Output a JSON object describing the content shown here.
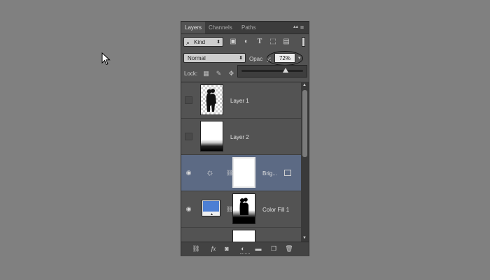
{
  "panel": {
    "tabs": [
      {
        "label": "Layers",
        "active": true
      },
      {
        "label": "Channels",
        "active": false
      },
      {
        "label": "Paths",
        "active": false
      }
    ]
  },
  "filter": {
    "kind_label": "Kind",
    "icons": [
      "image-filter-icon",
      "adjustment-filter-icon",
      "type-filter-icon",
      "shape-filter-icon",
      "smart-object-filter-icon"
    ]
  },
  "blend": {
    "mode": "Normal",
    "opacity_label_head": "Opac",
    "opacity_label_tail": "y:",
    "opacity_value": "72%",
    "opacity_fraction": 0.72
  },
  "lock": {
    "label": "Lock:"
  },
  "layers": [
    {
      "name": "Layer 1",
      "visible": false,
      "selected": false
    },
    {
      "name": "Layer 2",
      "visible": false,
      "selected": false
    },
    {
      "name": "Brig...",
      "visible": true,
      "selected": true
    },
    {
      "name": "Color Fill 1",
      "visible": true,
      "selected": false
    }
  ],
  "footer": {
    "fx_label": "fx"
  },
  "colors": {
    "panel_bg": "#535353",
    "selected_row": "#5c6a84",
    "color_fill": "#4d7fd4"
  }
}
